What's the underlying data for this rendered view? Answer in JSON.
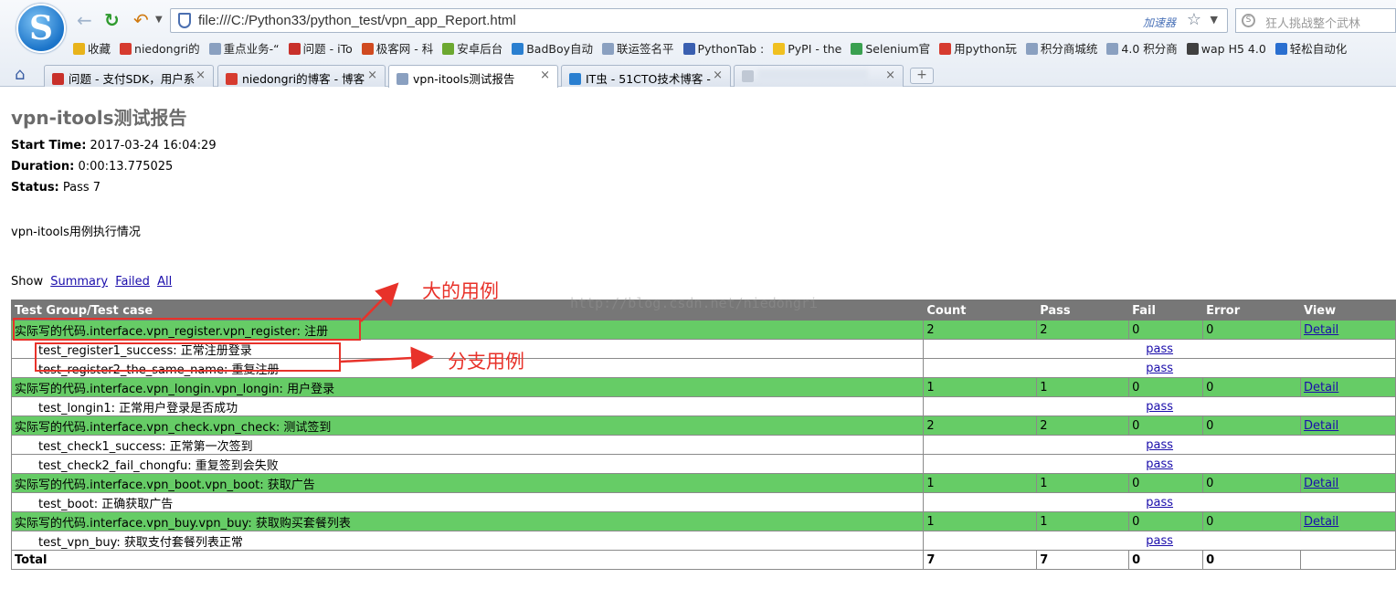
{
  "browser": {
    "url": "file:///C:/Python33/python_test/vpn_app_Report.html",
    "accelerator": "加速器",
    "search_placeholder": "狂人挑战整个武林",
    "bookmarks": [
      {
        "label": "收藏",
        "color": "#e8b31b"
      },
      {
        "label": "niedongri的",
        "color": "#d63b2f"
      },
      {
        "label": "重点业务-“",
        "color": "#8aa0c0"
      },
      {
        "label": "问题 - iTo",
        "color": "#c8302a"
      },
      {
        "label": "极客网 - 科",
        "color": "#d04a20"
      },
      {
        "label": "安卓后台",
        "color": "#6ca830"
      },
      {
        "label": "BadBoy自动",
        "color": "#2a7fd0"
      },
      {
        "label": "联运签名平",
        "color": "#8aa0c0"
      },
      {
        "label": "PythonTab :",
        "color": "#3a5fb0"
      },
      {
        "label": "PyPI - the",
        "color": "#f0c020"
      },
      {
        "label": "Selenium官",
        "color": "#3aa050"
      },
      {
        "label": "用python玩",
        "color": "#d63b2f"
      },
      {
        "label": "积分商城统",
        "color": "#8aa0c0"
      },
      {
        "label": "4.0 积分商",
        "color": "#8aa0c0"
      },
      {
        "label": "wap H5 4.0",
        "color": "#404040"
      },
      {
        "label": "轻松自动化",
        "color": "#2a6fd0"
      }
    ],
    "tabs": [
      {
        "label": "问题 - 支付SDK，用户系",
        "color": "#c8302a"
      },
      {
        "label": "niedongri的博客 - 博客",
        "color": "#d63b2f"
      },
      {
        "label": "vpn-itools测试报告",
        "color": "#8aa0c0"
      },
      {
        "label": "IT虫 - 51CTO技术博客 -",
        "color": "#2a7fd0"
      },
      {
        "label": "",
        "color": "#c0c8d4"
      }
    ]
  },
  "report": {
    "title": "vpn-itools测试报告",
    "start_time_label": "Start Time:",
    "start_time": "2017-03-24 16:04:29",
    "duration_label": "Duration:",
    "duration": "0:00:13.775025",
    "status_label": "Status:",
    "status": "Pass 7",
    "description": "vpn-itools用例执行情况",
    "show_label": "Show",
    "filters": [
      "Summary",
      "Failed",
      "All"
    ],
    "headers": [
      "Test Group/Test case",
      "Count",
      "Pass",
      "Fail",
      "Error",
      "View"
    ],
    "groups": [
      {
        "name": "实际写的代码.interface.vpn_register.vpn_register: 注册",
        "count": "2",
        "pass": "2",
        "fail": "0",
        "error": "0",
        "view": "Detail",
        "cases": [
          {
            "name": "test_register1_success: 正常注册登录",
            "result": "pass"
          },
          {
            "name": "test_register2_the_same_name: 重复注册",
            "result": "pass"
          }
        ]
      },
      {
        "name": "实际写的代码.interface.vpn_longin.vpn_longin: 用户登录",
        "count": "1",
        "pass": "1",
        "fail": "0",
        "error": "0",
        "view": "Detail",
        "cases": [
          {
            "name": "test_longin1: 正常用户登录是否成功",
            "result": "pass"
          }
        ]
      },
      {
        "name": "实际写的代码.interface.vpn_check.vpn_check: 测试签到",
        "count": "2",
        "pass": "2",
        "fail": "0",
        "error": "0",
        "view": "Detail",
        "cases": [
          {
            "name": "test_check1_success: 正常第一次签到",
            "result": "pass"
          },
          {
            "name": "test_check2_fail_chongfu: 重复签到会失败",
            "result": "pass"
          }
        ]
      },
      {
        "name": "实际写的代码.interface.vpn_boot.vpn_boot: 获取广告",
        "count": "1",
        "pass": "1",
        "fail": "0",
        "error": "0",
        "view": "Detail",
        "cases": [
          {
            "name": "test_boot: 正确获取广告",
            "result": "pass"
          }
        ]
      },
      {
        "name": "实际写的代码.interface.vpn_buy.vpn_buy: 获取购买套餐列表",
        "count": "1",
        "pass": "1",
        "fail": "0",
        "error": "0",
        "view": "Detail",
        "cases": [
          {
            "name": "test_vpn_buy: 获取支付套餐列表正常",
            "result": "pass"
          }
        ]
      }
    ],
    "total": {
      "label": "Total",
      "count": "7",
      "pass": "7",
      "fail": "0",
      "error": "0"
    }
  },
  "annotations": {
    "big_case": "大的用例",
    "branch_case": "分支用例",
    "watermark": "http://blog.csdn.net/niedongri",
    "color": "#e8322a"
  }
}
